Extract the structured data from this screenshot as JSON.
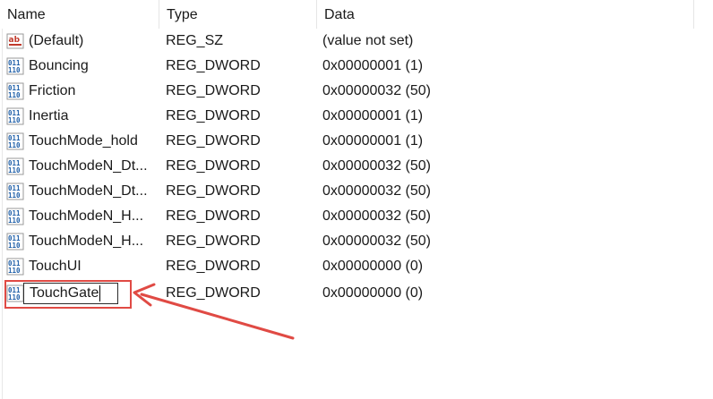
{
  "columns": {
    "name": "Name",
    "type": "Type",
    "data": "Data"
  },
  "rows": [
    {
      "icon": "string-value-icon",
      "name": "(Default)",
      "type": "REG_SZ",
      "data": "(value not set)"
    },
    {
      "icon": "dword-value-icon",
      "name": "Bouncing",
      "type": "REG_DWORD",
      "data": "0x00000001 (1)"
    },
    {
      "icon": "dword-value-icon",
      "name": "Friction",
      "type": "REG_DWORD",
      "data": "0x00000032 (50)"
    },
    {
      "icon": "dword-value-icon",
      "name": "Inertia",
      "type": "REG_DWORD",
      "data": "0x00000001 (1)"
    },
    {
      "icon": "dword-value-icon",
      "name": "TouchMode_hold",
      "type": "REG_DWORD",
      "data": "0x00000001 (1)"
    },
    {
      "icon": "dword-value-icon",
      "name": "TouchModeN_Dt...",
      "type": "REG_DWORD",
      "data": "0x00000032 (50)"
    },
    {
      "icon": "dword-value-icon",
      "name": "TouchModeN_Dt...",
      "type": "REG_DWORD",
      "data": "0x00000032 (50)"
    },
    {
      "icon": "dword-value-icon",
      "name": "TouchModeN_H...",
      "type": "REG_DWORD",
      "data": "0x00000032 (50)"
    },
    {
      "icon": "dword-value-icon",
      "name": "TouchModeN_H...",
      "type": "REG_DWORD",
      "data": "0x00000032 (50)"
    },
    {
      "icon": "dword-value-icon",
      "name": "TouchUI",
      "type": "REG_DWORD",
      "data": "0x00000000 (0)"
    }
  ],
  "editing_row": {
    "icon": "dword-value-icon",
    "name_value": "TouchGate",
    "type": "REG_DWORD",
    "data": "0x00000000 (0)"
  },
  "colors": {
    "annotation": "#e04a44",
    "string_icon": "#c0392b",
    "dword_icon": "#1f5fa8"
  }
}
